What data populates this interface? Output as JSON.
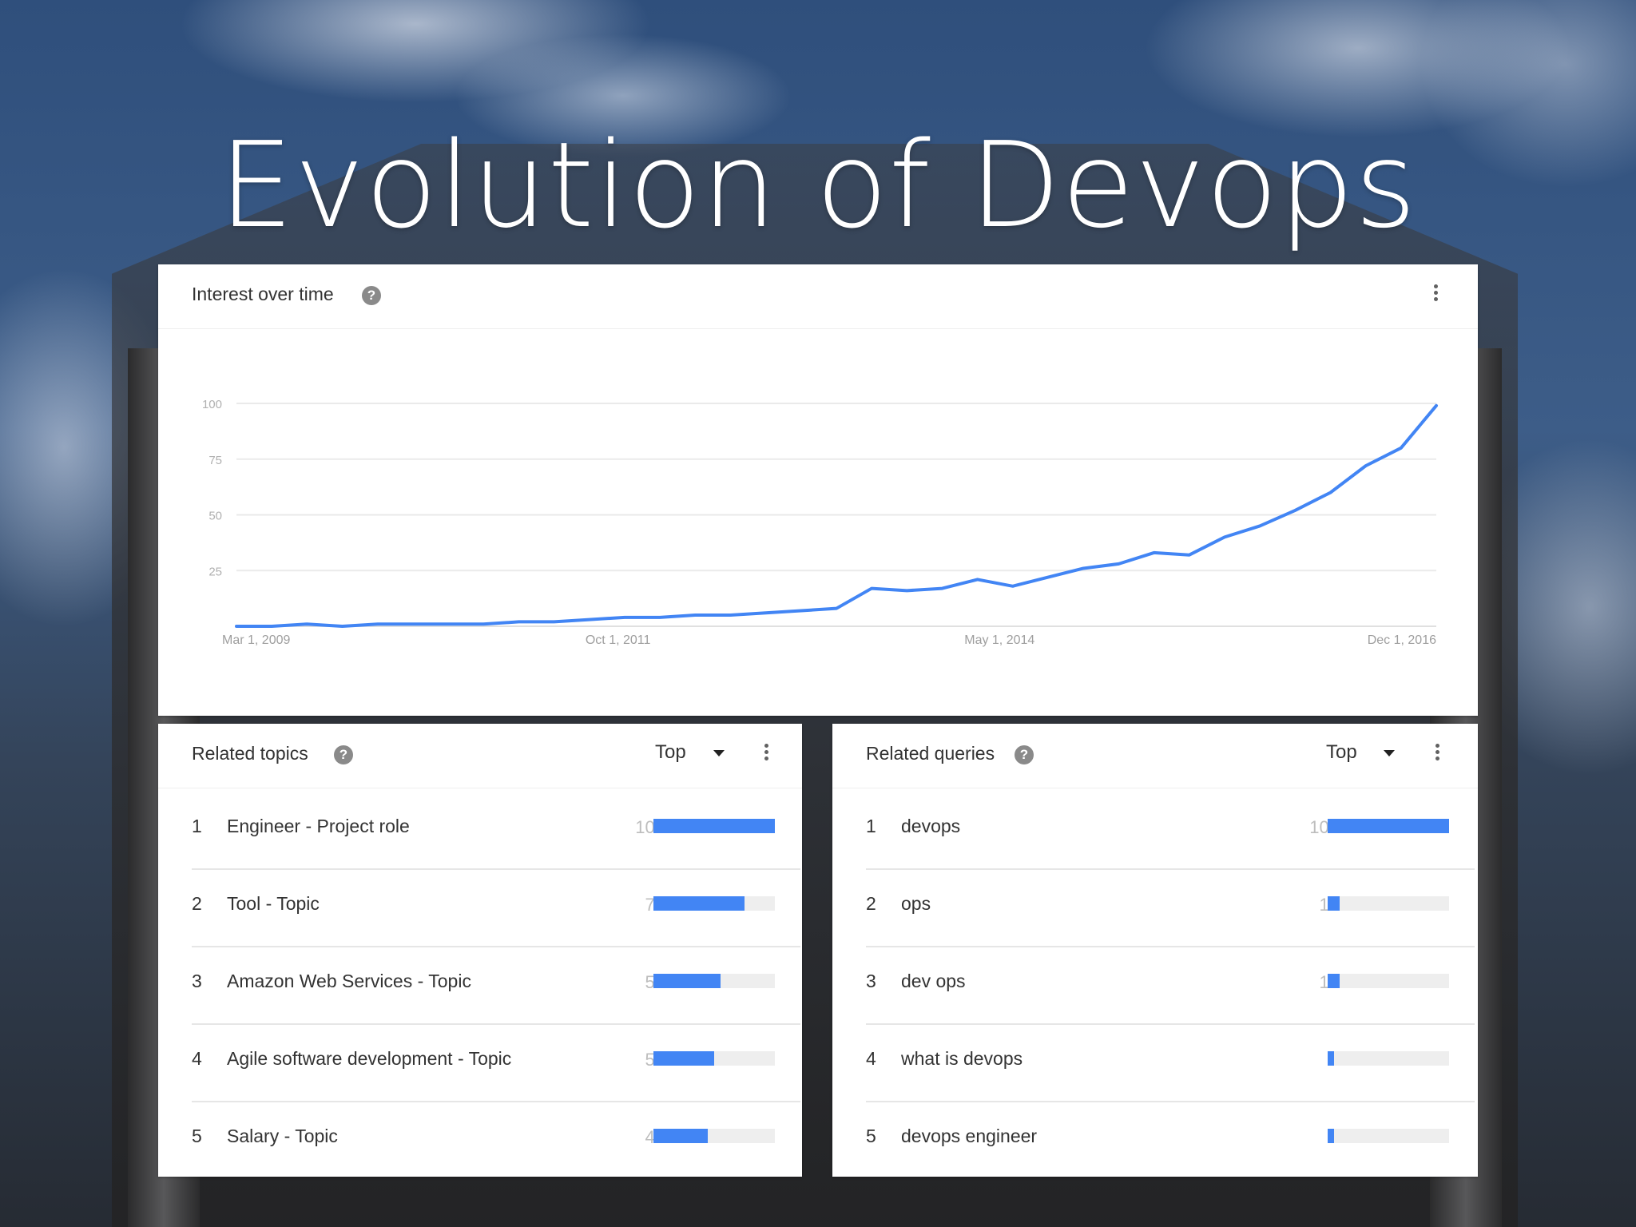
{
  "slide_title": "Evolution of Devops",
  "interest": {
    "title": "Interest over time",
    "chart_data": {
      "type": "line",
      "title": "",
      "xlabel": "",
      "ylabel": "",
      "ylim": [
        0,
        100
      ],
      "yticks": [
        25,
        50,
        75,
        100
      ],
      "grid": true,
      "xtick_labels": [
        "Mar 1, 2009",
        "Oct 1, 2011",
        "May 1, 2014",
        "Dec 1, 2016"
      ],
      "xrange": [
        "2009-03",
        "2017-02"
      ],
      "color": "#4285f4",
      "series": [
        {
          "values": [
            [
              "2009-03",
              0
            ],
            [
              "2009-06",
              0
            ],
            [
              "2009-09",
              1
            ],
            [
              "2009-12",
              0
            ],
            [
              "2010-03",
              1
            ],
            [
              "2010-06",
              1
            ],
            [
              "2010-09",
              1
            ],
            [
              "2010-12",
              1
            ],
            [
              "2011-03",
              2
            ],
            [
              "2011-06",
              2
            ],
            [
              "2011-09",
              3
            ],
            [
              "2011-12",
              4
            ],
            [
              "2012-03",
              4
            ],
            [
              "2012-06",
              5
            ],
            [
              "2012-09",
              5
            ],
            [
              "2012-12",
              6
            ],
            [
              "2013-03",
              7
            ],
            [
              "2013-06",
              8
            ],
            [
              "2013-09",
              17
            ],
            [
              "2013-12",
              16
            ],
            [
              "2014-03",
              17
            ],
            [
              "2014-06",
              21
            ],
            [
              "2014-09",
              18
            ],
            [
              "2014-12",
              22
            ],
            [
              "2015-03",
              26
            ],
            [
              "2015-06",
              28
            ],
            [
              "2015-09",
              33
            ],
            [
              "2015-12",
              32
            ],
            [
              "2016-03",
              40
            ],
            [
              "2016-06",
              45
            ],
            [
              "2016-09",
              52
            ],
            [
              "2016-12",
              60
            ],
            [
              "2017-03",
              72
            ],
            [
              "2017-06",
              80
            ],
            [
              "2017-09",
              99
            ]
          ]
        }
      ]
    }
  },
  "related_topics": {
    "title": "Related topics",
    "filter": "Top",
    "items": [
      {
        "rank": "1",
        "label": "Engineer - Project role",
        "value": "100",
        "pct": 100
      },
      {
        "rank": "2",
        "label": "Tool - Topic",
        "value": "75",
        "pct": 75
      },
      {
        "rank": "3",
        "label": "Amazon Web Services - Topic",
        "value": "55",
        "pct": 55
      },
      {
        "rank": "4",
        "label": "Agile software development - Topic",
        "value": "50",
        "pct": 50
      },
      {
        "rank": "5",
        "label": "Salary - Topic",
        "value": "45",
        "pct": 45
      }
    ]
  },
  "related_queries": {
    "title": "Related queries",
    "filter": "Top",
    "items": [
      {
        "rank": "1",
        "label": "devops",
        "value": "100",
        "pct": 100
      },
      {
        "rank": "2",
        "label": "ops",
        "value": "10",
        "pct": 10
      },
      {
        "rank": "3",
        "label": "dev ops",
        "value": "10",
        "pct": 10
      },
      {
        "rank": "4",
        "label": "what is devops",
        "value": "5",
        "pct": 5
      },
      {
        "rank": "5",
        "label": "devops engineer",
        "value": "5",
        "pct": 5
      }
    ]
  }
}
